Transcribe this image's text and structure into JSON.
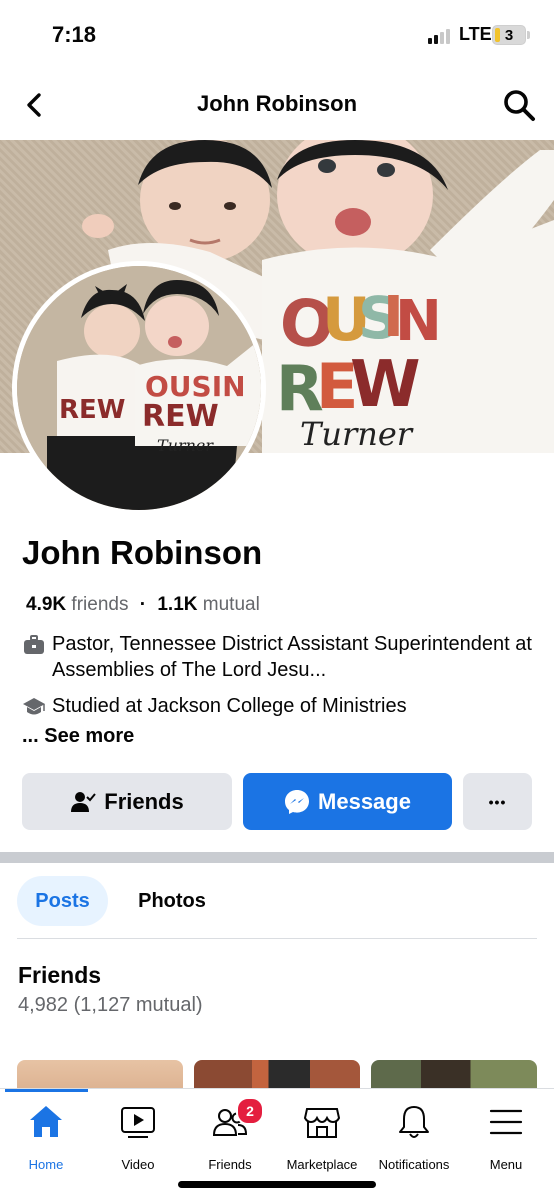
{
  "status_bar": {
    "time": "7:18",
    "network": "LTE",
    "battery": "3",
    "signal_bars_active": 2,
    "signal_bars_total": 4
  },
  "header": {
    "title": "John Robinson",
    "back_icon": "chevron-left-icon",
    "search_icon": "search-icon"
  },
  "profile": {
    "name": "John Robinson",
    "friends_count": "4.9K",
    "friends_word": "friends",
    "mutual_count": "1.1K",
    "mutual_word": "mutual",
    "work": "Pastor, Tennessee District Assistant Superintendent at Assemblies of The Lord Jesu...",
    "education": "Studied at Jackson College of Ministries",
    "see_more": "... See more",
    "cover_text_line1": "COUSIN",
    "cover_text_line2": "CREW",
    "cover_script": "Turner"
  },
  "actions": {
    "friends_label": "Friends",
    "message_label": "Message",
    "more_label": "•••"
  },
  "tabs": [
    {
      "label": "Posts",
      "active": true
    },
    {
      "label": "Photos",
      "active": false
    }
  ],
  "friends_section": {
    "title": "Friends",
    "count": "4,982 (1,127 mutual)"
  },
  "bottom_nav": [
    {
      "label": "Home",
      "icon": "home-icon",
      "active": true
    },
    {
      "label": "Video",
      "icon": "video-icon",
      "active": false
    },
    {
      "label": "Friends",
      "icon": "friends-icon",
      "active": false,
      "badge": "2"
    },
    {
      "label": "Marketplace",
      "icon": "marketplace-icon",
      "active": false
    },
    {
      "label": "Notifications",
      "icon": "bell-icon",
      "active": false
    },
    {
      "label": "Menu",
      "icon": "menu-icon",
      "active": false
    }
  ],
  "colors": {
    "accent": "#1b74e4",
    "badge": "#e41e3f",
    "secondary_text": "#65676b",
    "button_gray": "#e4e6eb"
  }
}
